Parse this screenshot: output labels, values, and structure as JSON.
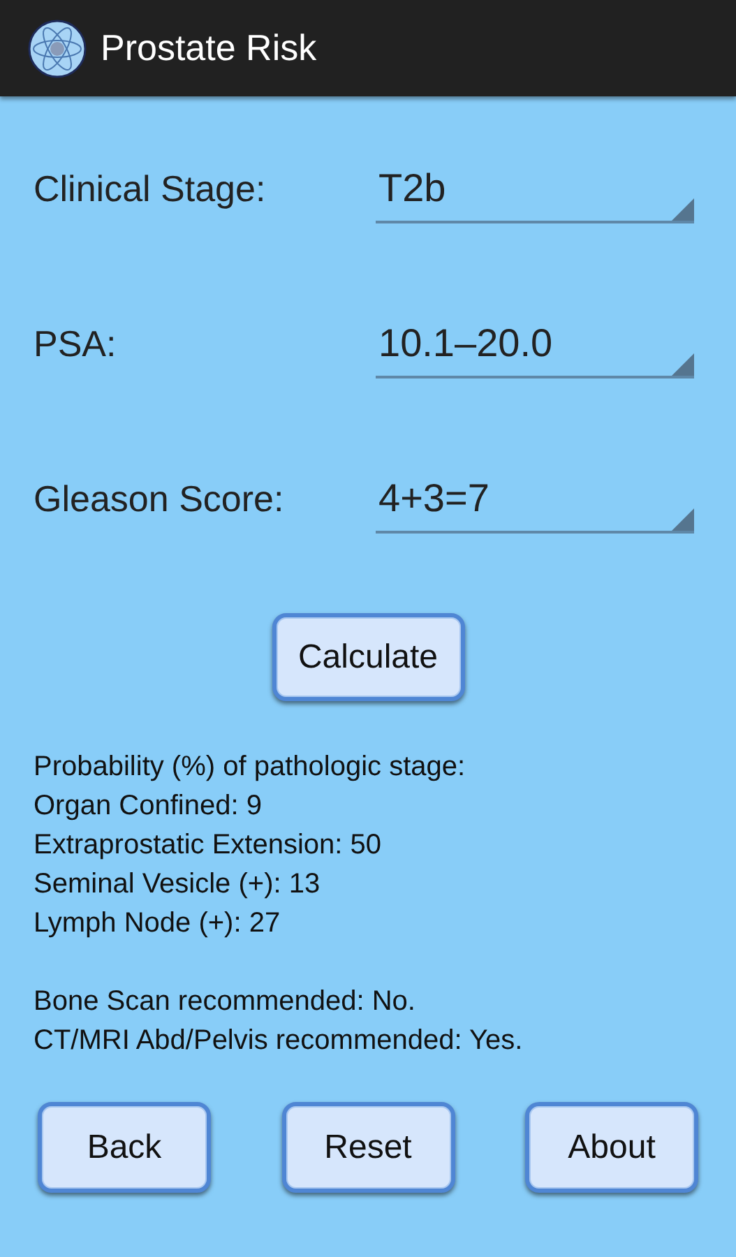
{
  "app_bar": {
    "title": "Prostate Risk"
  },
  "fields": [
    {
      "label": "Clinical Stage:",
      "value": "T2b"
    },
    {
      "label": "PSA:",
      "value": "10.1–20.0"
    },
    {
      "label": "Gleason Score:",
      "value": "4+3=7"
    }
  ],
  "calculate_button": "Calculate",
  "results": [
    [
      "Probability (%) of pathologic stage:",
      "Organ Confined: 9",
      "Extraprostatic Extension: 50",
      "Seminal Vesicle (+): 13",
      "Lymph Node (+): 27"
    ],
    [
      "Bone Scan recommended: No.",
      "CT/MRI Abd/Pelvis recommended: Yes."
    ]
  ],
  "buttons": [
    "Back",
    "Reset",
    "About"
  ]
}
